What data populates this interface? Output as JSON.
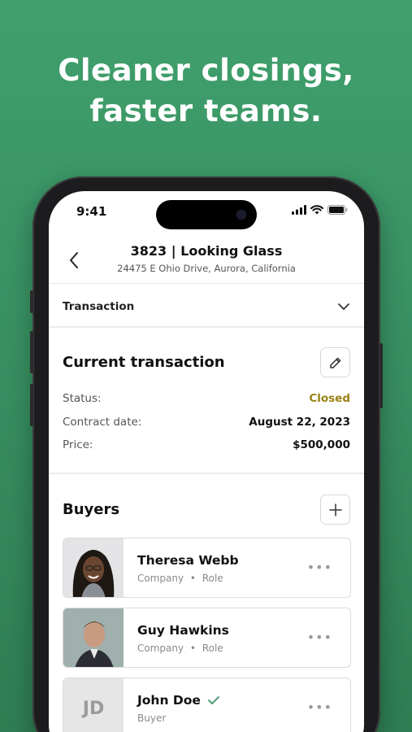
{
  "headline": {
    "line1": "Cleaner closings,",
    "line2": "faster teams."
  },
  "status_bar": {
    "time": "9:41"
  },
  "header": {
    "title": "3823 | Looking Glass",
    "subtitle": "24475 E Ohio Drive, Aurora, California"
  },
  "section": {
    "label": "Transaction"
  },
  "current_transaction": {
    "title": "Current transaction",
    "rows": [
      {
        "key": "Status:",
        "value": "Closed"
      },
      {
        "key": "Contract date:",
        "value": "August 22, 2023"
      },
      {
        "key": "Price:",
        "value": "$500,000"
      }
    ]
  },
  "buyers": {
    "title": "Buyers",
    "items": [
      {
        "name": "Theresa Webb",
        "company": "Company",
        "sep": "•",
        "role": "Role"
      },
      {
        "name": "Guy Hawkins",
        "company": "Company",
        "sep": "•",
        "role": "Role"
      },
      {
        "name": "John Doe",
        "initials": "JD",
        "role": "Buyer"
      }
    ]
  },
  "colors": {
    "accent": "#3a9464",
    "status_closed": "#9a8214"
  }
}
